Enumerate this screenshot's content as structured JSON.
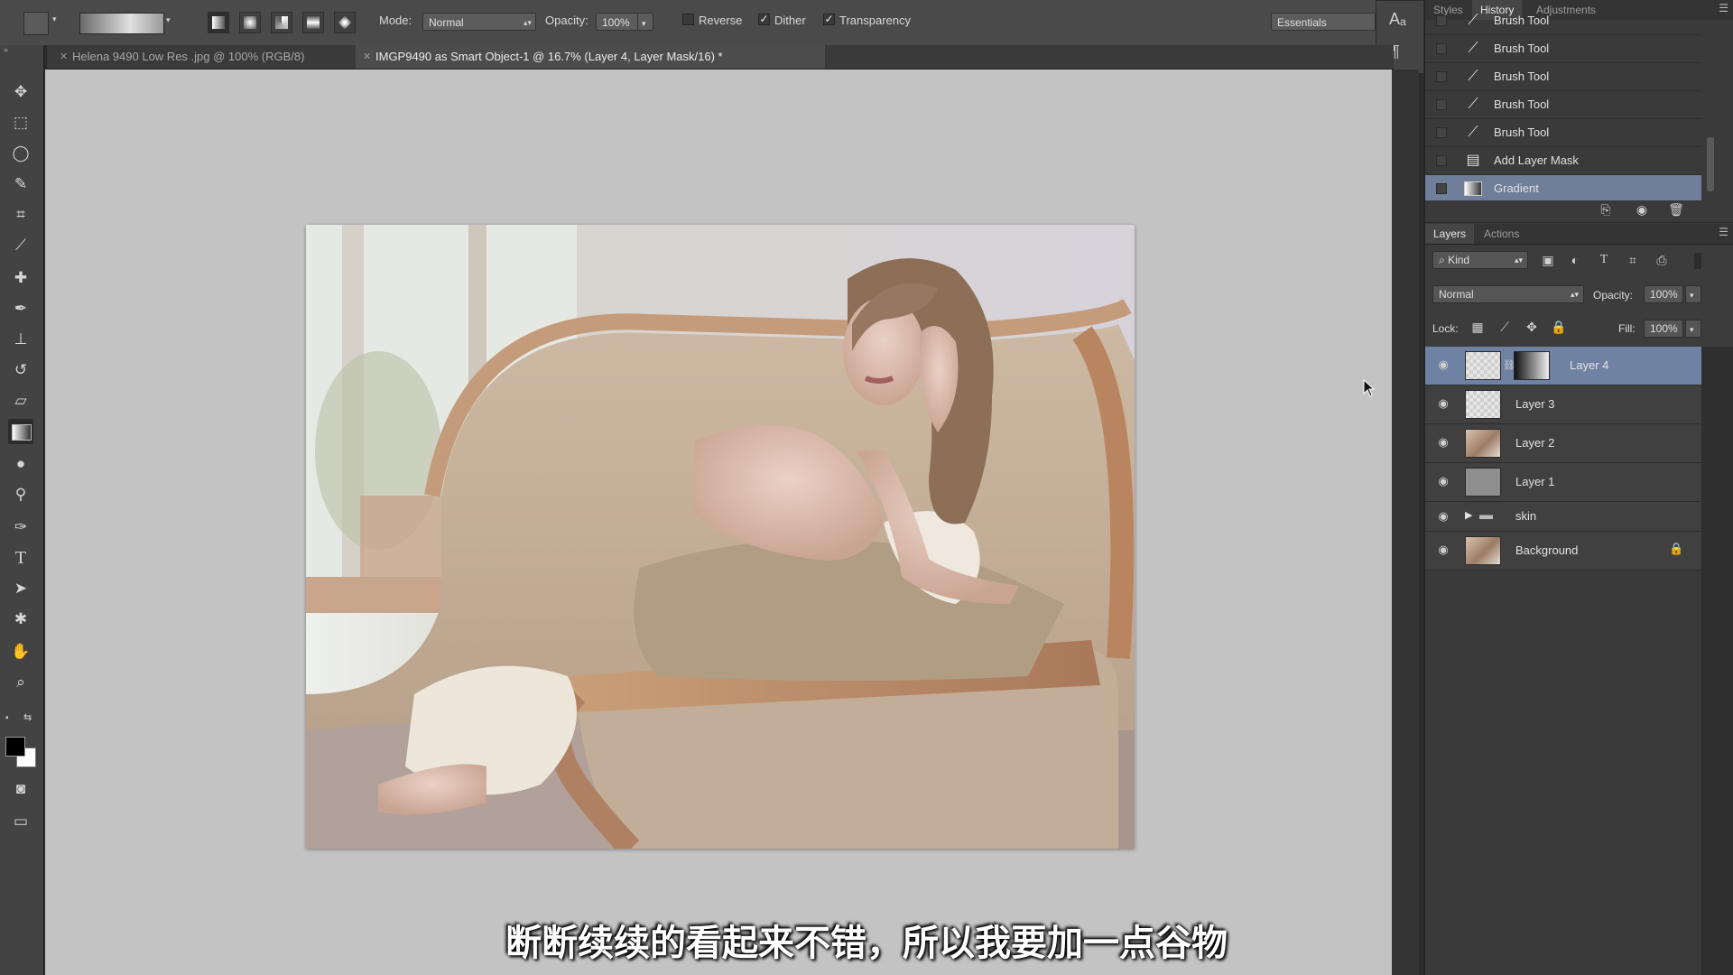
{
  "options_bar": {
    "mode_label": "Mode:",
    "mode_value": "Normal",
    "opacity_label": "Opacity:",
    "opacity_value": "100%",
    "reverse_label": "Reverse",
    "dither_label": "Dither",
    "transparency_label": "Transparency",
    "workspace_value": "Essentials"
  },
  "tabs": [
    {
      "label": "Helena 9490 Low Res .jpg @ 100% (RGB/8)"
    },
    {
      "label": "IMGP9490 as Smart Object-1 @ 16.7% (Layer 4, Layer Mask/16) *"
    }
  ],
  "toolbar": {
    "icons": [
      "move-icon",
      "marquee-icon",
      "lasso-icon",
      "quick-select-icon",
      "crop-icon",
      "eyedropper-icon",
      "healing-icon",
      "brush-icon",
      "stamp-icon",
      "history-brush-icon",
      "eraser-icon",
      "gradient-icon",
      "blur-icon",
      "dodge-icon",
      "pen-icon",
      "type-icon",
      "path-select-icon",
      "shape-icon",
      "hand-icon",
      "zoom-icon"
    ]
  },
  "history_panel": {
    "tabs": [
      "Styles",
      "History",
      "Adjustments"
    ],
    "active_tab": "History",
    "items": [
      {
        "label": "Brush Tool",
        "icon": "brush-icon"
      },
      {
        "label": "Brush Tool",
        "icon": "brush-icon"
      },
      {
        "label": "Brush Tool",
        "icon": "brush-icon"
      },
      {
        "label": "Brush Tool",
        "icon": "brush-icon"
      },
      {
        "label": "Brush Tool",
        "icon": "brush-icon"
      },
      {
        "label": "Add Layer Mask",
        "icon": "layer-mask-icon"
      },
      {
        "label": "Gradient",
        "icon": "gradient-icon"
      }
    ]
  },
  "layers_panel": {
    "tabs": [
      "Layers",
      "Actions"
    ],
    "active_tab": "Layers",
    "filter_value": "Kind",
    "blend_mode": "Normal",
    "opacity_label": "Opacity:",
    "opacity_value": "100%",
    "lock_label": "Lock:",
    "fill_label": "Fill:",
    "fill_value": "100%",
    "layers": [
      {
        "name": "Layer 4"
      },
      {
        "name": "Layer 3"
      },
      {
        "name": "Layer 2"
      },
      {
        "name": "Layer 1"
      },
      {
        "name": "skin"
      },
      {
        "name": "Background"
      }
    ]
  },
  "subtitle": "断断续续的看起来不错，所以我要加一点谷物",
  "colors": {
    "selection": "#6f82a3",
    "canvas_bg": "#c3c3c3"
  }
}
